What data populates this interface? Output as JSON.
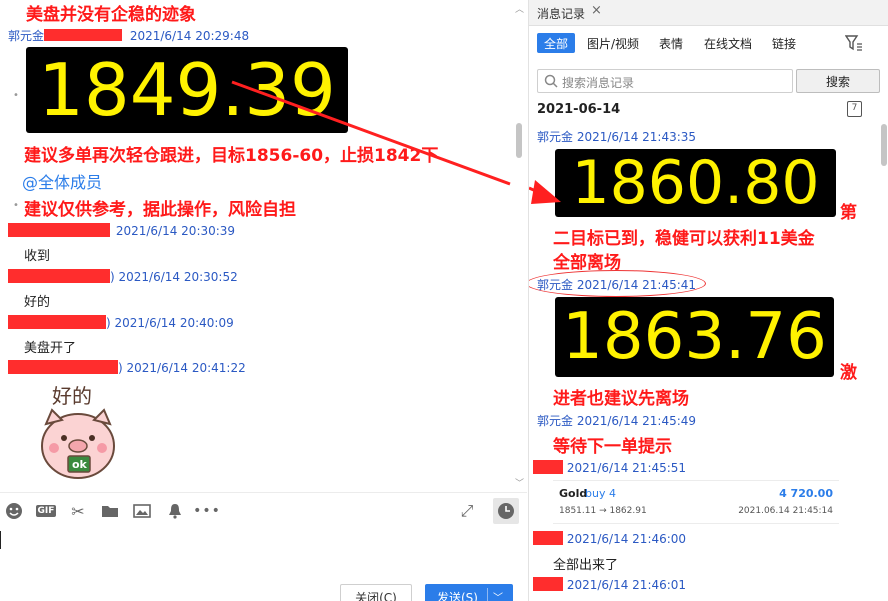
{
  "left": {
    "headline": "美盘并没有企稳的迹象",
    "sender1_name": "郭元金",
    "sender1_time": "2021/6/14 20:29:48",
    "price1": "1849.39",
    "advice_line1": "建议多单再次轻仓跟进，目标1856-60，止损1842下",
    "mention": "@全体成员",
    "advice_line2": "建议仅供参考，据此操作，风险自担",
    "msg2_time": "2021/6/14 20:30:39",
    "msg2_text": "收到",
    "msg3_time": ") 2021/6/14 20:30:52",
    "msg3_text": "好的",
    "msg4_time": ") 2021/6/14 20:40:09",
    "msg4_text": "美盘开了",
    "msg5_time": ") 2021/6/14 20:41:22",
    "sticker_text": "好的",
    "sticker_ok": "ok",
    "toolbar": {
      "emoji_icon": "smile-icon",
      "gif_label": "GIF",
      "close_label": "关闭(C)",
      "send_label": "发送(S)"
    }
  },
  "right": {
    "tab_title": "消息记录",
    "tab_close": "×",
    "categories": [
      "全部",
      "图片/视频",
      "表情",
      "在线文档",
      "链接"
    ],
    "search_placeholder": "搜索消息记录",
    "search_button": "搜索",
    "date_header": "2021-06-14",
    "calendar_day": "7",
    "m1_sender": "郭元金 2021/6/14 21:43:35",
    "price2": "1860.80",
    "m1_tail": "第",
    "m1_line2": "二目标已到，稳健可以获利11美金",
    "m1_line3": "全部离场",
    "m2_sender": "郭元金 2021/6/14 21:45:41",
    "price3": "1863.76",
    "m2_tail": "激",
    "m2_line2": "进者也建议先离场",
    "m3_sender": "郭元金 2021/6/14 21:45:49",
    "m3_text": "等待下一单提示",
    "m4_time": "2021/6/14 21:45:51",
    "card": {
      "symbol": "Gold",
      "side": "buy 4",
      "amount": "4 720.00",
      "prices": "1851.11 → 1862.91",
      "closed": "2021.06.14 21:45:14"
    },
    "m5_time": "2021/6/14 21:46:00",
    "m5_text": "全部出来了",
    "m6_time": "2021/6/14 21:46:01"
  },
  "colors": {
    "annotation_red": "#ff1a1a",
    "ticker_yellow": "#fff200",
    "link_blue": "#2b59c3",
    "accent_blue": "#2b7de9"
  }
}
